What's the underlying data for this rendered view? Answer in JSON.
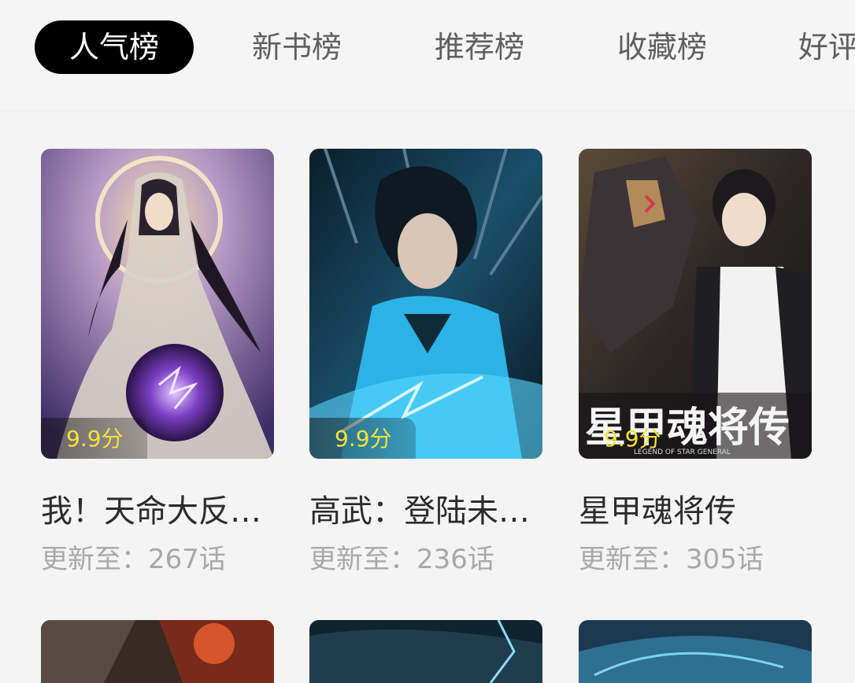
{
  "tabs": [
    {
      "label": "人气榜",
      "active": true
    },
    {
      "label": "新书榜",
      "active": false
    },
    {
      "label": "推荐榜",
      "active": false
    },
    {
      "label": "收藏榜",
      "active": false
    },
    {
      "label": "好评",
      "active": false
    }
  ],
  "books": [
    {
      "title": "我！天命大反…",
      "score": "9.9分",
      "update": "更新至：267话",
      "cover_colors": [
        "#4a3a72",
        "#e9d59a"
      ]
    },
    {
      "title": "高武：登陆未…",
      "score": "9.9分",
      "update": "更新至：236话",
      "cover_colors": [
        "#0d2a3a",
        "#35c4ff"
      ]
    },
    {
      "title": "星甲魂将传",
      "score": "9.9分",
      "update": "更新至：305话",
      "cover_colors": [
        "#2a2424",
        "#f2f2f2"
      ],
      "cover_text": "星甲魂将传",
      "cover_subtext": "LEGEND OF STAR GENERAL"
    }
  ],
  "accent": "#f4e23a"
}
